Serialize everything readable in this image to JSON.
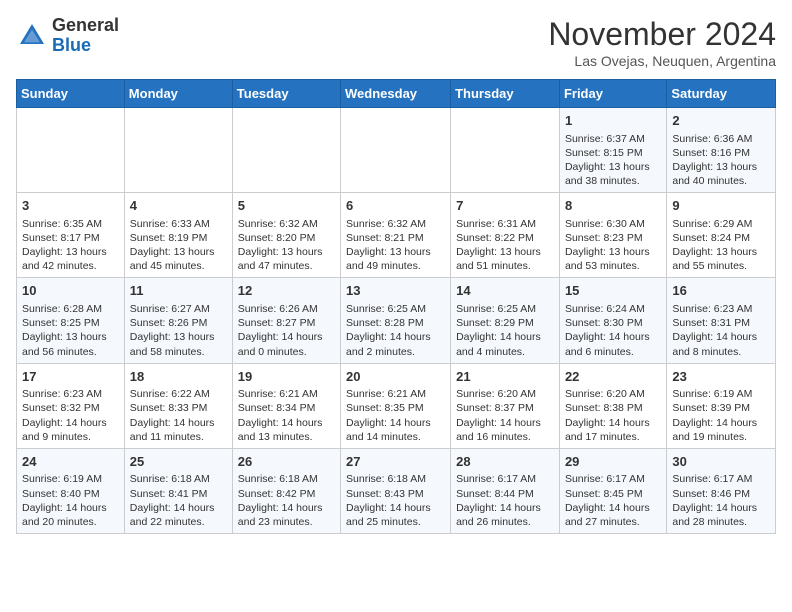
{
  "header": {
    "logo_general": "General",
    "logo_blue": "Blue",
    "month_title": "November 2024",
    "subtitle": "Las Ovejas, Neuquen, Argentina"
  },
  "weekdays": [
    "Sunday",
    "Monday",
    "Tuesday",
    "Wednesday",
    "Thursday",
    "Friday",
    "Saturday"
  ],
  "weeks": [
    [
      {
        "day": "",
        "info": ""
      },
      {
        "day": "",
        "info": ""
      },
      {
        "day": "",
        "info": ""
      },
      {
        "day": "",
        "info": ""
      },
      {
        "day": "",
        "info": ""
      },
      {
        "day": "1",
        "info": "Sunrise: 6:37 AM\nSunset: 8:15 PM\nDaylight: 13 hours and 38 minutes."
      },
      {
        "day": "2",
        "info": "Sunrise: 6:36 AM\nSunset: 8:16 PM\nDaylight: 13 hours and 40 minutes."
      }
    ],
    [
      {
        "day": "3",
        "info": "Sunrise: 6:35 AM\nSunset: 8:17 PM\nDaylight: 13 hours and 42 minutes."
      },
      {
        "day": "4",
        "info": "Sunrise: 6:33 AM\nSunset: 8:19 PM\nDaylight: 13 hours and 45 minutes."
      },
      {
        "day": "5",
        "info": "Sunrise: 6:32 AM\nSunset: 8:20 PM\nDaylight: 13 hours and 47 minutes."
      },
      {
        "day": "6",
        "info": "Sunrise: 6:32 AM\nSunset: 8:21 PM\nDaylight: 13 hours and 49 minutes."
      },
      {
        "day": "7",
        "info": "Sunrise: 6:31 AM\nSunset: 8:22 PM\nDaylight: 13 hours and 51 minutes."
      },
      {
        "day": "8",
        "info": "Sunrise: 6:30 AM\nSunset: 8:23 PM\nDaylight: 13 hours and 53 minutes."
      },
      {
        "day": "9",
        "info": "Sunrise: 6:29 AM\nSunset: 8:24 PM\nDaylight: 13 hours and 55 minutes."
      }
    ],
    [
      {
        "day": "10",
        "info": "Sunrise: 6:28 AM\nSunset: 8:25 PM\nDaylight: 13 hours and 56 minutes."
      },
      {
        "day": "11",
        "info": "Sunrise: 6:27 AM\nSunset: 8:26 PM\nDaylight: 13 hours and 58 minutes."
      },
      {
        "day": "12",
        "info": "Sunrise: 6:26 AM\nSunset: 8:27 PM\nDaylight: 14 hours and 0 minutes."
      },
      {
        "day": "13",
        "info": "Sunrise: 6:25 AM\nSunset: 8:28 PM\nDaylight: 14 hours and 2 minutes."
      },
      {
        "day": "14",
        "info": "Sunrise: 6:25 AM\nSunset: 8:29 PM\nDaylight: 14 hours and 4 minutes."
      },
      {
        "day": "15",
        "info": "Sunrise: 6:24 AM\nSunset: 8:30 PM\nDaylight: 14 hours and 6 minutes."
      },
      {
        "day": "16",
        "info": "Sunrise: 6:23 AM\nSunset: 8:31 PM\nDaylight: 14 hours and 8 minutes."
      }
    ],
    [
      {
        "day": "17",
        "info": "Sunrise: 6:23 AM\nSunset: 8:32 PM\nDaylight: 14 hours and 9 minutes."
      },
      {
        "day": "18",
        "info": "Sunrise: 6:22 AM\nSunset: 8:33 PM\nDaylight: 14 hours and 11 minutes."
      },
      {
        "day": "19",
        "info": "Sunrise: 6:21 AM\nSunset: 8:34 PM\nDaylight: 14 hours and 13 minutes."
      },
      {
        "day": "20",
        "info": "Sunrise: 6:21 AM\nSunset: 8:35 PM\nDaylight: 14 hours and 14 minutes."
      },
      {
        "day": "21",
        "info": "Sunrise: 6:20 AM\nSunset: 8:37 PM\nDaylight: 14 hours and 16 minutes."
      },
      {
        "day": "22",
        "info": "Sunrise: 6:20 AM\nSunset: 8:38 PM\nDaylight: 14 hours and 17 minutes."
      },
      {
        "day": "23",
        "info": "Sunrise: 6:19 AM\nSunset: 8:39 PM\nDaylight: 14 hours and 19 minutes."
      }
    ],
    [
      {
        "day": "24",
        "info": "Sunrise: 6:19 AM\nSunset: 8:40 PM\nDaylight: 14 hours and 20 minutes."
      },
      {
        "day": "25",
        "info": "Sunrise: 6:18 AM\nSunset: 8:41 PM\nDaylight: 14 hours and 22 minutes."
      },
      {
        "day": "26",
        "info": "Sunrise: 6:18 AM\nSunset: 8:42 PM\nDaylight: 14 hours and 23 minutes."
      },
      {
        "day": "27",
        "info": "Sunrise: 6:18 AM\nSunset: 8:43 PM\nDaylight: 14 hours and 25 minutes."
      },
      {
        "day": "28",
        "info": "Sunrise: 6:17 AM\nSunset: 8:44 PM\nDaylight: 14 hours and 26 minutes."
      },
      {
        "day": "29",
        "info": "Sunrise: 6:17 AM\nSunset: 8:45 PM\nDaylight: 14 hours and 27 minutes."
      },
      {
        "day": "30",
        "info": "Sunrise: 6:17 AM\nSunset: 8:46 PM\nDaylight: 14 hours and 28 minutes."
      }
    ]
  ]
}
